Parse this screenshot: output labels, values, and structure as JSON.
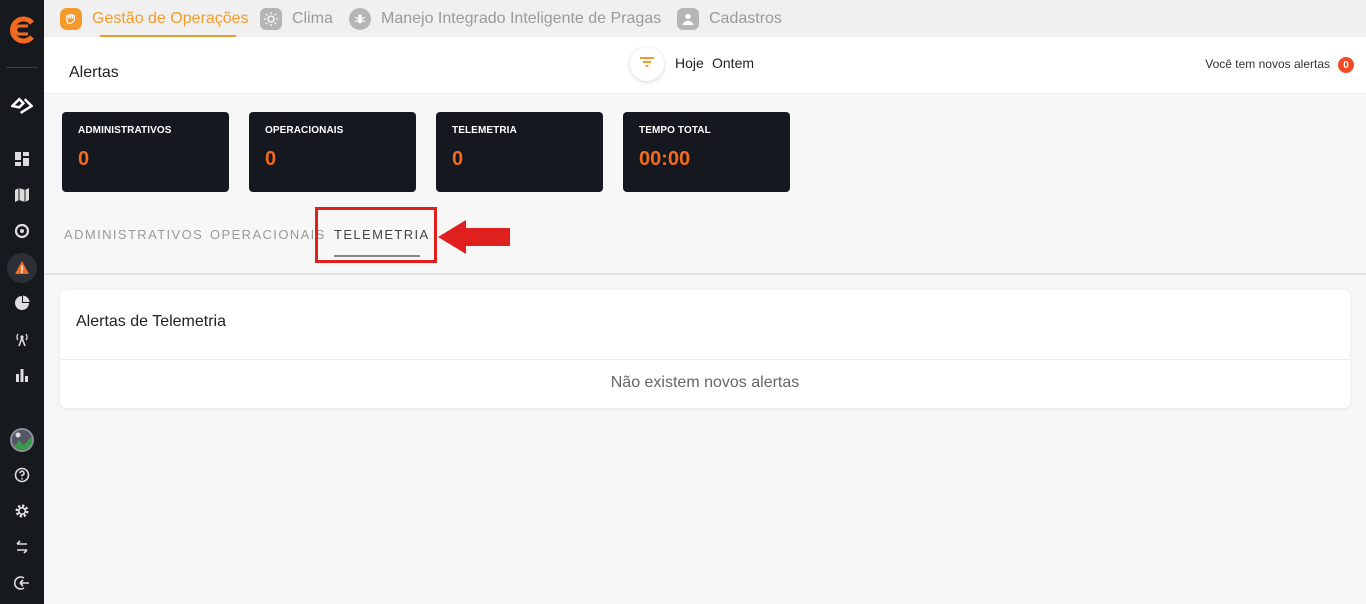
{
  "nav": {
    "items": [
      {
        "label": "Gestão de Operações"
      },
      {
        "label": "Clima"
      },
      {
        "label": "Manejo Integrado Inteligente de Pragas"
      },
      {
        "label": "Cadastros"
      }
    ]
  },
  "header": {
    "title": "Alertas",
    "day_filters": [
      "Hoje",
      "Ontem"
    ],
    "new_alerts_text": "Você tem novos alertas",
    "new_alerts_count": "0"
  },
  "cards": [
    {
      "label": "ADMINISTRATIVOS",
      "value": "0"
    },
    {
      "label": "OPERACIONAIS",
      "value": "0"
    },
    {
      "label": "TELEMETRIA",
      "value": "0"
    },
    {
      "label": "TEMPO TOTAL",
      "value": "00:00"
    }
  ],
  "tabs": [
    {
      "label": "ADMINISTRATIVOS"
    },
    {
      "label": "OPERACIONAIS"
    },
    {
      "label": "TELEMETRIA"
    }
  ],
  "panel": {
    "title": "Alertas de Telemetria",
    "empty_message": "Não existem novos alertas"
  },
  "colors": {
    "accent": "#f39a2a",
    "card_value": "#f36a1f",
    "sidebar": "#16191e",
    "annotation": "#e0201e"
  }
}
